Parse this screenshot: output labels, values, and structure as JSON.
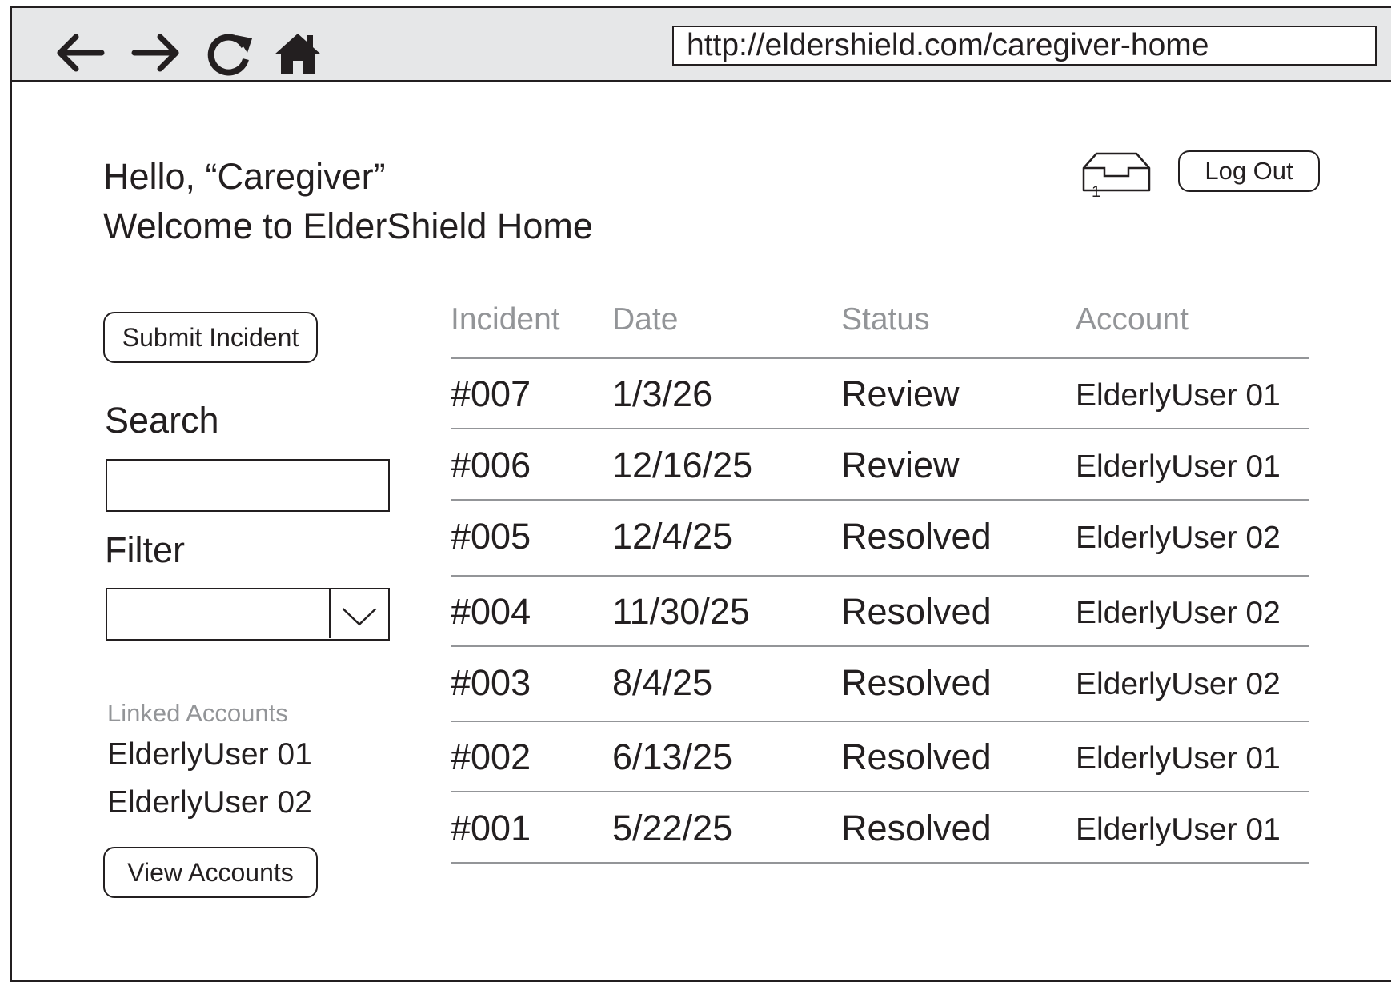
{
  "browser": {
    "url": "http://eldershield.com/caregiver-home"
  },
  "header": {
    "greeting": "Hello, “Caregiver”",
    "welcome": "Welcome to ElderShield Home",
    "inbox_count": "1",
    "logout_label": "Log Out"
  },
  "sidebar": {
    "submit_label": "Submit Incident",
    "search_label": "Search",
    "search_value": "",
    "filter_label": "Filter",
    "filter_value": "",
    "linked_title": "Linked Accounts",
    "linked_accounts": [
      "ElderlyUser 01",
      "ElderlyUser 02"
    ],
    "view_accounts_label": "View Accounts"
  },
  "table": {
    "columns": [
      "Incident",
      "Date",
      "Status",
      "Account"
    ],
    "rows": [
      {
        "incident": "#007",
        "date": "1/3/26",
        "status": "Review",
        "account": "ElderlyUser 01"
      },
      {
        "incident": "#006",
        "date": "12/16/25",
        "status": "Review",
        "account": "ElderlyUser 01"
      },
      {
        "incident": "#005",
        "date": "12/4/25",
        "status": "Resolved",
        "account": "ElderlyUser 02"
      },
      {
        "incident": "#004",
        "date": "11/30/25",
        "status": "Resolved",
        "account": "ElderlyUser 02"
      },
      {
        "incident": "#003",
        "date": "8/4/25",
        "status": "Resolved",
        "account": "ElderlyUser 02"
      },
      {
        "incident": "#002",
        "date": "6/13/25",
        "status": "Resolved",
        "account": "ElderlyUser 01"
      },
      {
        "incident": "#001",
        "date": "5/22/25",
        "status": "Resolved",
        "account": "ElderlyUser 01"
      }
    ]
  },
  "icons": {
    "back": "back-arrow-icon",
    "forward": "forward-arrow-icon",
    "reload": "reload-icon",
    "home": "home-icon",
    "inbox": "inbox-icon",
    "dropdown": "chevron-down-icon"
  },
  "colors": {
    "ink": "#231f20",
    "muted": "#939598",
    "browser_bar": "#e6e7e8"
  }
}
